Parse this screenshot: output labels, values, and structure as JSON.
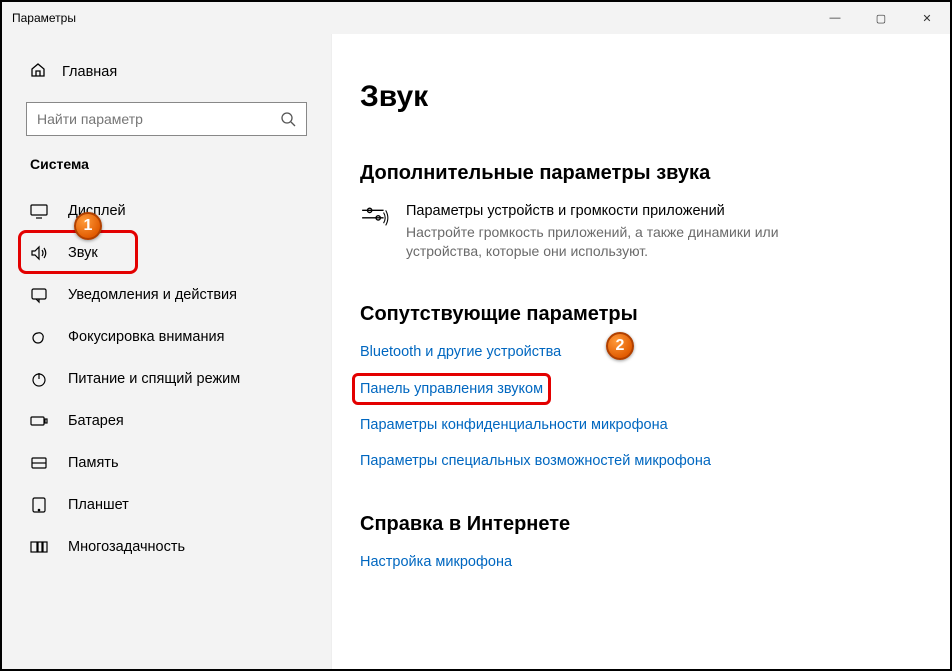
{
  "window": {
    "title": "Параметры",
    "controls": {
      "min": "—",
      "max": "▢",
      "close": "✕"
    }
  },
  "sidebar": {
    "home": "Главная",
    "search_placeholder": "Найти параметр",
    "section": "Система",
    "items": [
      {
        "label": "Дисплей",
        "icon": "display-icon"
      },
      {
        "label": "Звук",
        "icon": "sound-icon",
        "selected": true
      },
      {
        "label": "Уведомления и действия",
        "icon": "notifications-icon"
      },
      {
        "label": "Фокусировка внимания",
        "icon": "focus-icon"
      },
      {
        "label": "Питание и спящий режим",
        "icon": "power-icon"
      },
      {
        "label": "Батарея",
        "icon": "battery-icon"
      },
      {
        "label": "Память",
        "icon": "storage-icon"
      },
      {
        "label": "Планшет",
        "icon": "tablet-icon"
      },
      {
        "label": "Многозадачность",
        "icon": "multitask-icon"
      }
    ]
  },
  "main": {
    "title": "Звук",
    "advanced": {
      "heading": "Дополнительные параметры звука",
      "item_title": "Параметры устройств и громкости приложений",
      "item_desc": "Настройте громкость приложений, а также динамики или устройства, которые они используют."
    },
    "related": {
      "heading": "Сопутствующие параметры",
      "links": [
        "Bluetooth и другие устройства",
        "Панель управления звуком",
        "Параметры конфиденциальности микрофона",
        "Параметры специальных возможностей микрофона"
      ]
    },
    "help": {
      "heading": "Справка в Интернете",
      "links": [
        "Настройка микрофона"
      ]
    }
  },
  "markers": {
    "one": "1",
    "two": "2"
  }
}
